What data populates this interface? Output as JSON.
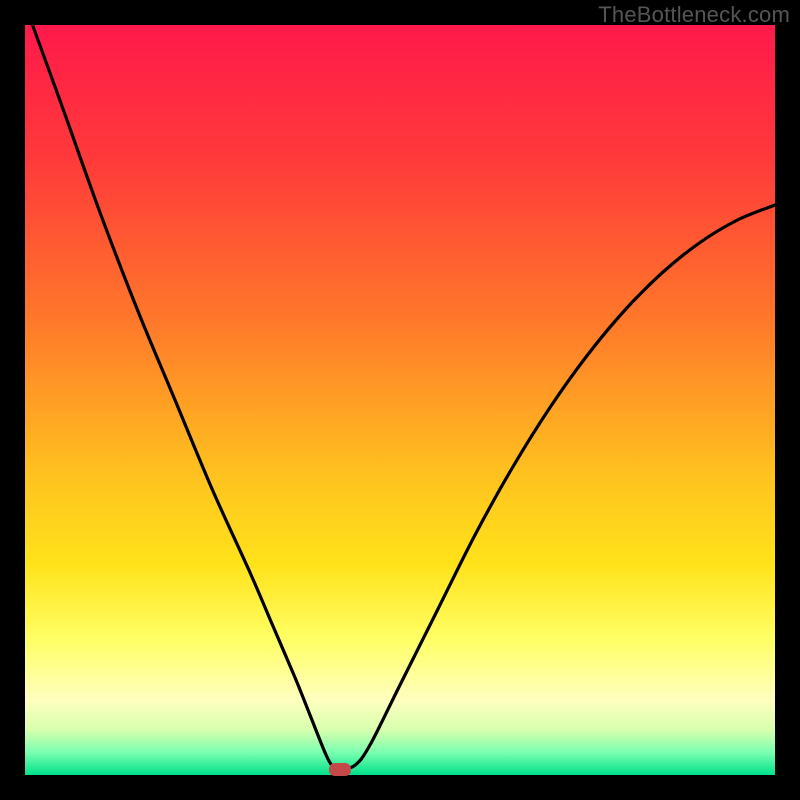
{
  "watermark": "TheBottleneck.com",
  "colors": {
    "frame": "#000000",
    "curve": "#000000",
    "gradient_stops": [
      {
        "pct": 0,
        "color": "#ff1a4b"
      },
      {
        "pct": 18,
        "color": "#ff3a3a"
      },
      {
        "pct": 40,
        "color": "#ff7a2a"
      },
      {
        "pct": 60,
        "color": "#ffc21f"
      },
      {
        "pct": 72,
        "color": "#ffe31a"
      },
      {
        "pct": 82,
        "color": "#ffff66"
      },
      {
        "pct": 90,
        "color": "#ffffc0"
      },
      {
        "pct": 94,
        "color": "#d7ffad"
      },
      {
        "pct": 97,
        "color": "#7affb0"
      },
      {
        "pct": 100,
        "color": "#00e08a"
      }
    ],
    "marker": "#c44a4a"
  },
  "chart_data": {
    "type": "line",
    "title": "",
    "xlabel": "",
    "ylabel": "",
    "xlim": [
      0,
      100
    ],
    "ylim": [
      0,
      100
    ],
    "grid": false,
    "legend": false,
    "minimum_marker": {
      "x": 42,
      "y": 0.8
    },
    "series": [
      {
        "name": "bottleneck-curve",
        "x": [
          1,
          5,
          10,
          15,
          20,
          25,
          30,
          33,
          36,
          38,
          40,
          41,
          42,
          44,
          46,
          50,
          55,
          60,
          65,
          70,
          75,
          80,
          85,
          90,
          95,
          100
        ],
        "values": [
          100,
          89,
          75,
          62,
          50,
          38,
          27,
          20,
          13,
          8,
          3,
          1.2,
          0.8,
          1.3,
          4,
          12,
          22,
          32,
          41,
          49,
          56,
          62,
          67,
          71,
          74,
          76
        ]
      }
    ]
  }
}
